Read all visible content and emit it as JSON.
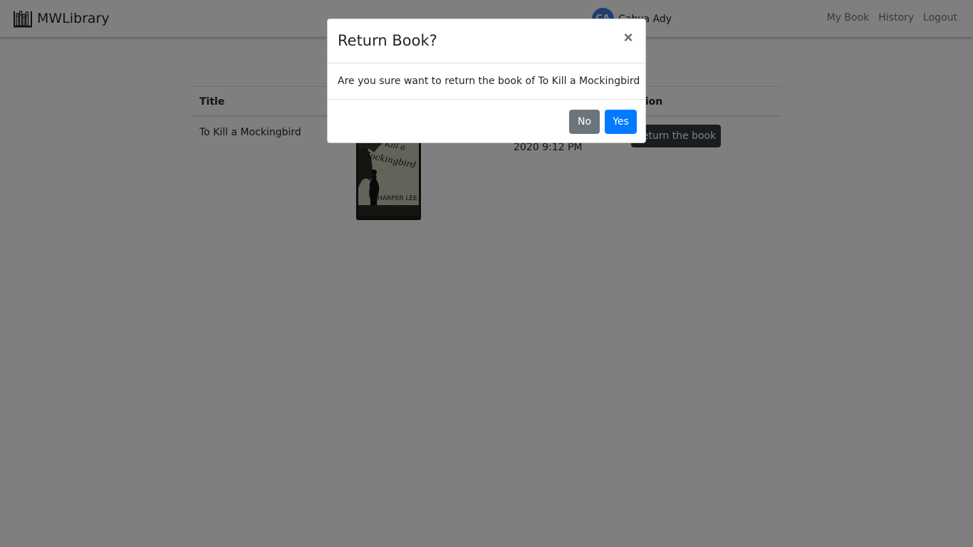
{
  "navbar": {
    "brand": "MWLibrary",
    "brand_icon": "library-icon",
    "user": {
      "initials": "CA",
      "name": "Cahya Ady"
    },
    "links": [
      "My Book",
      "History",
      "Logout"
    ]
  },
  "table": {
    "headers": {
      "title": "Title",
      "action": "Action"
    },
    "rows": [
      {
        "title": "To Kill a Mockingbird",
        "cover": {
          "title": "To Kill a Mockingbird",
          "author": "HARPER LEE"
        },
        "date": "2020 9:12 PM",
        "action_label": "Return the book"
      }
    ]
  },
  "modal": {
    "title": "Return Book?",
    "close_symbol": "×",
    "message": "Are you sure want to return the book of To Kill a Mockingbird",
    "no_label": "No",
    "yes_label": "Yes"
  },
  "colors": {
    "primary": "#007bff",
    "secondary": "#6c757d",
    "dark": "#343a40",
    "avatar": "#3b7ddd"
  }
}
